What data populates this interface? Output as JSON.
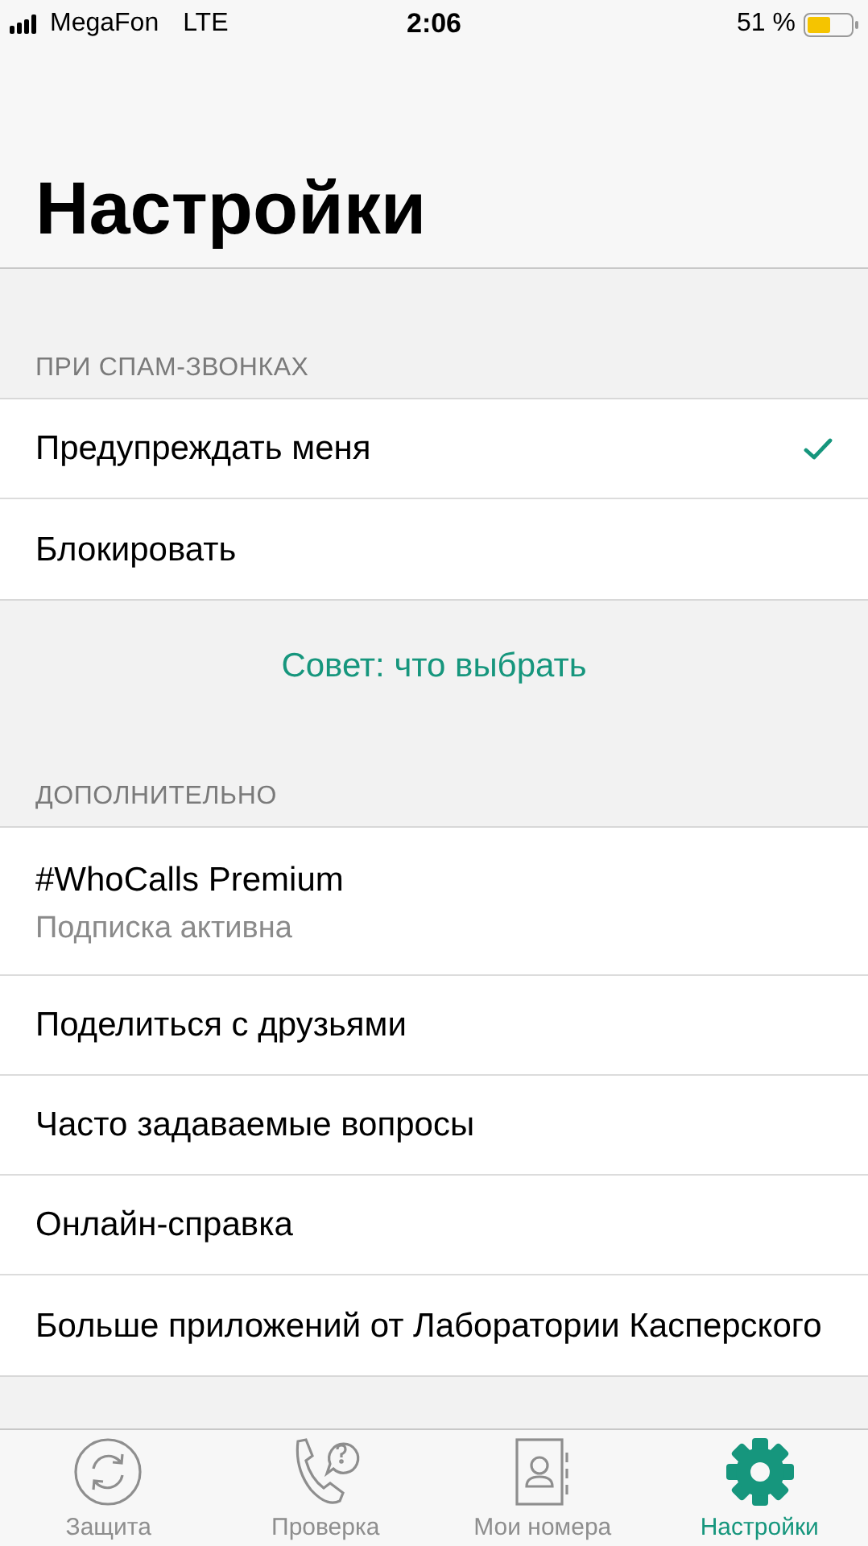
{
  "status_bar": {
    "carrier": "MegaFon",
    "network": "LTE",
    "time": "2:06",
    "battery_text": "51 %"
  },
  "title": "Настройки",
  "sections": [
    {
      "header": "ПРИ СПАМ-ЗВОНКАХ",
      "kind": "choice",
      "items": [
        {
          "label": "Предупреждать меня",
          "checked": true
        },
        {
          "label": "Блокировать",
          "checked": false
        }
      ],
      "footer_link": "Совет: что выбрать"
    },
    {
      "header": "ДОПОЛНИТЕЛЬНО",
      "kind": "menu",
      "items": [
        {
          "label": "#WhoCalls Premium",
          "subtitle": "Подписка активна"
        },
        {
          "label": "Поделиться с друзьями"
        },
        {
          "label": "Часто задаваемые вопросы"
        },
        {
          "label": "Онлайн-справка"
        },
        {
          "label": "Больше приложений от Лаборатории Касперского"
        }
      ]
    }
  ],
  "tabs": [
    {
      "kind": "protection",
      "label": "Защита",
      "selected": false
    },
    {
      "kind": "check",
      "label": "Проверка",
      "selected": false
    },
    {
      "kind": "numbers",
      "label": "Мои номера",
      "selected": false
    },
    {
      "kind": "settings",
      "label": "Настройки",
      "selected": true
    }
  ]
}
